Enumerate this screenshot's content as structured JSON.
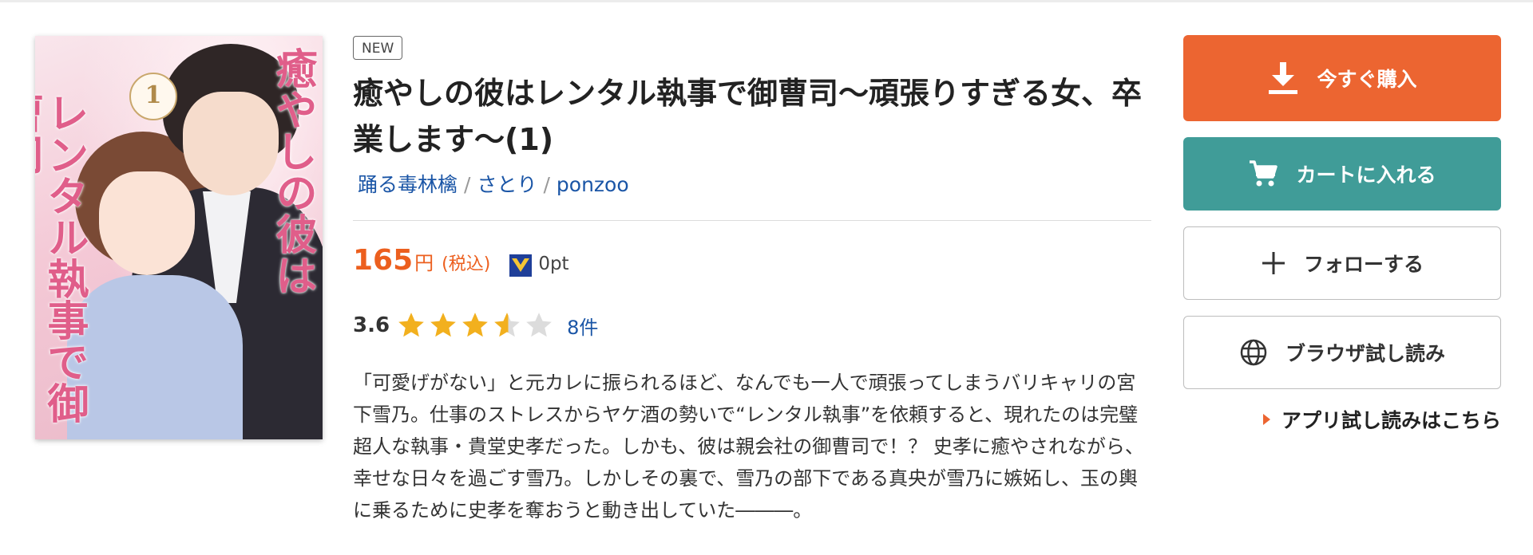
{
  "cover": {
    "title_vertical_1": "癒やしの彼は",
    "title_vertical_2": "レンタル執事で御曹司",
    "volume": "1"
  },
  "badge": "NEW",
  "title": "癒やしの彼はレンタル執事で御曹司〜頑張りすぎる女、卒業します〜(1)",
  "authors": [
    "踊る毒林檎",
    "さとり",
    "ponzoo"
  ],
  "author_separator": "/",
  "price": {
    "amount": "165",
    "currency": "円",
    "tax_note": "(税込)",
    "points": "0pt",
    "accent_color": "#ec5f1e"
  },
  "rating": {
    "score": "3.6",
    "stars_value": 3.6,
    "stars_max": 5,
    "count": "8件"
  },
  "description": "「可愛げがない」と元カレに振られるほど、なんでも一人で頑張ってしまうバリキャリの宮下雪乃。仕事のストレスからヤケ酒の勢いで“レンタル執事”を依頼すると、現れたのは完璧超人な執事・貴堂史孝だった。しかも、彼は親会社の御曹司で！？ 史孝に癒やされながら、幸せな日々を過ごす雪乃。しかしその裏で、雪乃の部下である真央が雪乃に嫉妬し、玉の輿に乗るために史孝を奪おうと動き出していた―――。",
  "buttons": {
    "buy": {
      "label": "今すぐ購入",
      "icon": "download-icon",
      "color": "#ec6531"
    },
    "cart": {
      "label": "カートに入れる",
      "icon": "cart-icon",
      "color": "#409c98"
    },
    "follow": {
      "label": "フォローする",
      "icon": "plus-icon"
    },
    "browser_preview": {
      "label": "ブラウザ試し読み",
      "icon": "globe-icon"
    }
  },
  "app_preview_link": "アプリ試し読みはこちら"
}
